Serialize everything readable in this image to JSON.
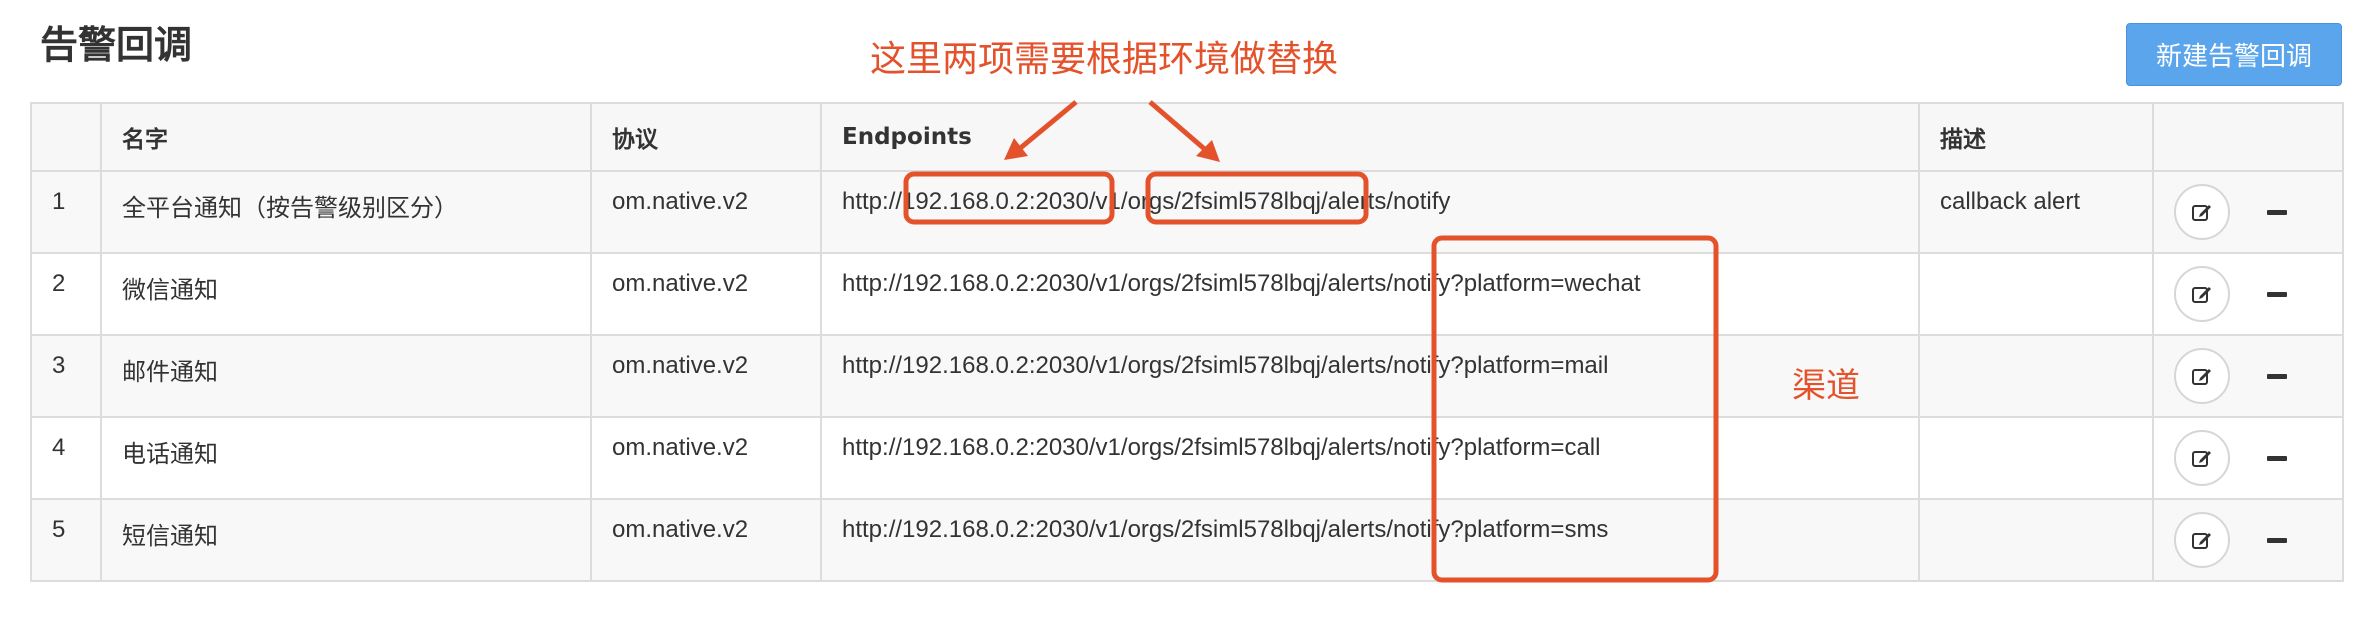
{
  "page": {
    "title": "告警回调",
    "new_button_label": "新建告警回调"
  },
  "annotations": {
    "top_note": "这里两项需要根据环境做替换",
    "channel_note": "渠道",
    "color": "#e4522c"
  },
  "table": {
    "headers": [
      "",
      "名字",
      "协议",
      "Endpoints",
      "描述",
      ""
    ],
    "rows": [
      {
        "index": "1",
        "name": "全平台通知（按告警级别区分）",
        "protocol": "om.native.v2",
        "endpoint": "http://192.168.0.2:2030/v1/orgs/2fsiml578lbqj/alerts/notify",
        "description": "callback alert"
      },
      {
        "index": "2",
        "name": "微信通知",
        "protocol": "om.native.v2",
        "endpoint": "http://192.168.0.2:2030/v1/orgs/2fsiml578lbqj/alerts/notify?platform=wechat",
        "description": ""
      },
      {
        "index": "3",
        "name": "邮件通知",
        "protocol": "om.native.v2",
        "endpoint": "http://192.168.0.2:2030/v1/orgs/2fsiml578lbqj/alerts/notify?platform=mail",
        "description": ""
      },
      {
        "index": "4",
        "name": "电话通知",
        "protocol": "om.native.v2",
        "endpoint": "http://192.168.0.2:2030/v1/orgs/2fsiml578lbqj/alerts/notify?platform=call",
        "description": ""
      },
      {
        "index": "5",
        "name": "短信通知",
        "protocol": "om.native.v2",
        "endpoint": "http://192.168.0.2:2030/v1/orgs/2fsiml578lbqj/alerts/notify?platform=sms",
        "description": ""
      }
    ],
    "row_actions": [
      {
        "edit_icon": "edit-icon",
        "remove_icon": "minus-icon"
      }
    ]
  }
}
